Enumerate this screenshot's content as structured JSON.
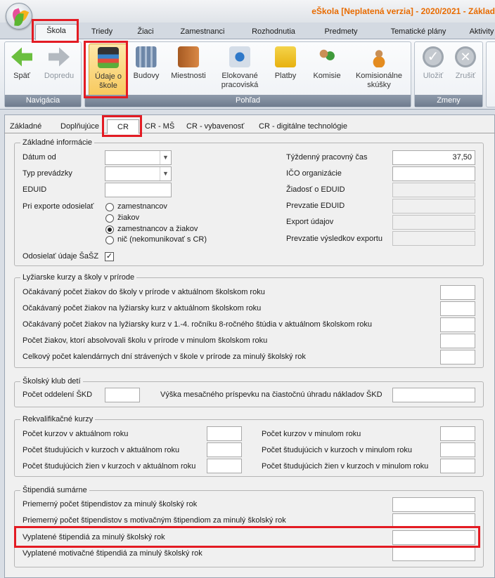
{
  "window": {
    "title": "eŠkola [Neplatená verzia] - 2020/2021 - Základ"
  },
  "ribbon_tabs": [
    "Škola",
    "Triedy",
    "Žiaci",
    "Zamestnanci",
    "Rozhodnutia",
    "Predmety",
    "Tematické plány",
    "Aktivity"
  ],
  "ribbon": {
    "groups": {
      "nav": "Navigácia",
      "view": "Pohľad",
      "changes": "Zmeny"
    },
    "back": "Späť",
    "forward": "Dopredu",
    "school_1": "Údaje o",
    "school_2": "škole",
    "buildings": "Budovy",
    "rooms": "Miestnosti",
    "loc_1": "Elokované",
    "loc_2": "pracoviská",
    "payments": "Platby",
    "committees": "Komisie",
    "exam_1": "Komisionálne",
    "exam_2": "skúšky",
    "save": "Uložiť",
    "cancel": "Zrušiť"
  },
  "subtabs": [
    "Základné",
    "Doplňujúce",
    "CR",
    "CR - MŠ",
    "CR - vybavenosť",
    "CR - digitálne technológie"
  ],
  "basic": {
    "legend": "Základné informácie",
    "date_from": "Dátum od",
    "operation_type": "Typ prevádzky",
    "eduid": "EDUID",
    "export_send": "Pri exporte odosielať",
    "radio_employees": "zamestnancov",
    "radio_students": "žiakov",
    "radio_both": "zamestnancov a žiakov",
    "radio_none": "nič (nekomunikovať s CR)",
    "send_sasz": "Odosielať údaje ŠaŠZ",
    "weekly_time": "Týždenný pracovný čas",
    "weekly_time_value": "37,50",
    "ico": "IČO organizácie",
    "eduid_request": "Žiadosť o EDUID",
    "eduid_takeover": "Prevzatie EDUID",
    "export_data": "Export údajov",
    "export_results": "Prevzatie výsledkov exportu"
  },
  "ski": {
    "legend": "Lyžiarske kurzy a školy v prírode",
    "rows": [
      "Očakávaný počet žiakov do školy v prírode v aktuálnom školskom roku",
      "Očakávaný počet žiakov na lyžiarsky kurz v aktuálnom školskom roku",
      "Očakávaný počet žiakov na lyžiarsky kurz v 1.-4. ročníku 8-ročného štúdia v aktuálnom školskom roku",
      "Počet žiakov, ktorí absolvovali školu v prírode v minulom školskom roku",
      "Celkový počet kalendárnych dní strávených v škole v prírode za minulý školský rok"
    ]
  },
  "skd": {
    "legend": "Školský klub detí",
    "departments": "Počet oddelení ŠKD",
    "fee": "Výška mesačného príspevku na čiastočnú úhradu nákladov ŠKD"
  },
  "requal": {
    "legend": "Rekvalifikačné kurzy",
    "left": [
      "Počet kurzov v aktuálnom roku",
      "Počet študujúcich v kurzoch v aktuálnom roku",
      "Počet študujúcich žien v kurzoch v aktuálnom roku"
    ],
    "right": [
      "Počet kurzov v minulom roku",
      "Počet študujúcich v kurzoch v minulom roku",
      "Počet študujúcich žien v kurzoch v minulom roku"
    ]
  },
  "stipend": {
    "legend": "Štipendiá sumárne",
    "rows": [
      "Priemerný počet štipendistov za minulý školský rok",
      "Priemerný počet štipendistov s motivačným štipendiom za minulý školský rok",
      "Vyplatené štipendiá za minulý školský rok",
      "Vyplatené motivačné štipendiá za minulý školský rok"
    ]
  }
}
